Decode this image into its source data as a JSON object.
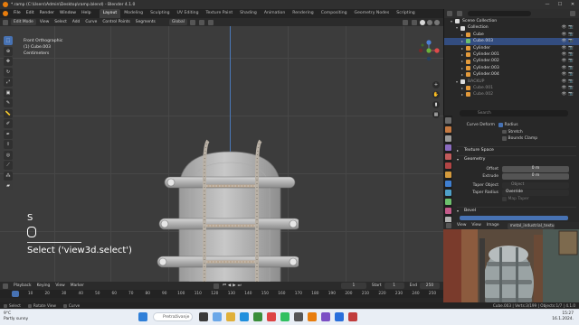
{
  "window": {
    "title": "*.ramp (C:\\Users\\Admin\\Desktop\\ramp.blend) - Blender 4.1.0",
    "controls": [
      "—",
      "☐",
      "✕"
    ]
  },
  "menubar": {
    "menus": [
      "File",
      "Edit",
      "Render",
      "Window",
      "Help"
    ],
    "workspaces": [
      "Layout",
      "Modeling",
      "Sculpting",
      "UV Editing",
      "Texture Paint",
      "Shading",
      "Animation",
      "Rendering",
      "Compositing",
      "Geometry Nodes",
      "Scripting"
    ],
    "active_workspace": "Layout",
    "scene_label": "Scene",
    "view_layer_label": "ViewLayer"
  },
  "viewport_header": {
    "mode": "Edit Mode",
    "menus": [
      "View",
      "Select",
      "Add",
      "Curve",
      "Control Points",
      "Segments"
    ],
    "orientation": "Global"
  },
  "viewport_info": {
    "view_name": "Front Orthographic",
    "object": "(1) Cube.003",
    "units": "Centimeters"
  },
  "keycast": {
    "key": "S",
    "operator": "Select ('view3d.select')"
  },
  "outliner": {
    "rows": [
      {
        "label": "Scene Collection",
        "indent": 0,
        "icon": "collection",
        "selected": false,
        "dim": false
      },
      {
        "label": "Collection",
        "indent": 1,
        "icon": "collection",
        "selected": false,
        "dim": false
      },
      {
        "label": "Cube",
        "indent": 2,
        "icon": "mesh",
        "selected": false,
        "dim": false
      },
      {
        "label": "Cube.003",
        "indent": 2,
        "icon": "curve",
        "selected": true,
        "dim": false
      },
      {
        "label": "Cylinder",
        "indent": 2,
        "icon": "mesh",
        "selected": false,
        "dim": false
      },
      {
        "label": "Cylinder.001",
        "indent": 2,
        "icon": "mesh",
        "selected": false,
        "dim": false
      },
      {
        "label": "Cylinder.002",
        "indent": 2,
        "icon": "mesh",
        "selected": false,
        "dim": false
      },
      {
        "label": "Cylinder.003",
        "indent": 2,
        "icon": "mesh",
        "selected": false,
        "dim": false
      },
      {
        "label": "Cylinder.004",
        "indent": 2,
        "icon": "mesh",
        "selected": false,
        "dim": false
      },
      {
        "label": "BACKUP",
        "indent": 1,
        "icon": "collection",
        "selected": false,
        "dim": true
      },
      {
        "label": "Cube.001",
        "indent": 2,
        "icon": "mesh",
        "selected": false,
        "dim": true
      },
      {
        "label": "Cube.002",
        "indent": 2,
        "icon": "mesh",
        "selected": false,
        "dim": true
      }
    ]
  },
  "properties": {
    "search_placeholder": "Search",
    "curve_deform_label": "Curve Deform",
    "checkbox_radius": "Radius",
    "checkbox_stretch": "Stretch",
    "checkbox_bounds_clamp": "Bounds Clamp",
    "section_texture_space": "Texture Space",
    "section_geometry": "Geometry",
    "offset_label": "Offset",
    "offset_value": "0 m",
    "extrude_label": "Extrude",
    "extrude_value": "0 m",
    "taper_object_label": "Taper Object",
    "taper_object_value": "Object",
    "taper_radius_label": "Taper Radius",
    "taper_radius_value": "Override",
    "map_taper_label": "Map Taper",
    "section_bevel": "Bevel"
  },
  "image_editor": {
    "menus": [
      "View",
      "View",
      "Image"
    ],
    "image_name": "metal_industrial_textures"
  },
  "timeline": {
    "menus": [
      "Playback",
      "Keying",
      "View",
      "Marker"
    ],
    "current_frame": "1",
    "start_label": "Start",
    "start_value": "1",
    "end_label": "End",
    "end_value": "250",
    "ticks": [
      "1",
      "10",
      "20",
      "30",
      "40",
      "50",
      "60",
      "70",
      "80",
      "90",
      "100",
      "110",
      "120",
      "130",
      "140",
      "150",
      "160",
      "170",
      "180",
      "190",
      "200",
      "210",
      "220",
      "230",
      "240",
      "250"
    ]
  },
  "statusbar": {
    "left": [
      "Select",
      "Rotate View",
      "Curve"
    ],
    "right": "Cube.003 | Verts:3/199 | Objects:1/7 | 4.1.0"
  },
  "taskbar": {
    "weather_temp": "9°C",
    "weather_desc": "Partly sunny",
    "search_placeholder": "Pretraživanje",
    "time": "15:27",
    "date": "16.1.2024."
  },
  "colors": {
    "accent_blue": "#4772b3",
    "selection": "#334d80",
    "blender_orange": "#e87d0d",
    "object_gray": "#bfbfbf"
  }
}
